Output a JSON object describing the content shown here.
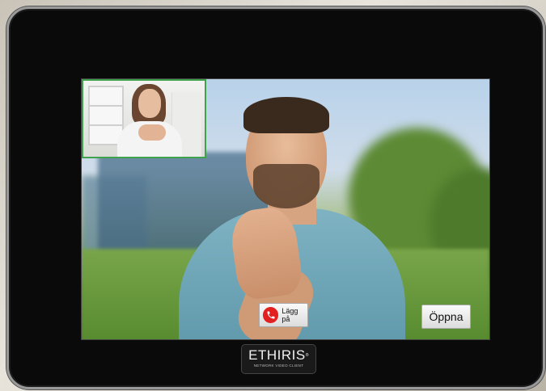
{
  "call": {
    "hangup_label": "Lägg på",
    "open_label": "Öppna"
  },
  "branding": {
    "name": "ETHIRIS",
    "trademark": "®",
    "tagline": "NETWORK VIDEO CLIENT"
  },
  "icons": {
    "hangup": "phone-hangup-icon"
  },
  "colors": {
    "hangup_red": "#e32020",
    "pip_border": "#3fa34d",
    "bezel": "#0a0a0a"
  }
}
